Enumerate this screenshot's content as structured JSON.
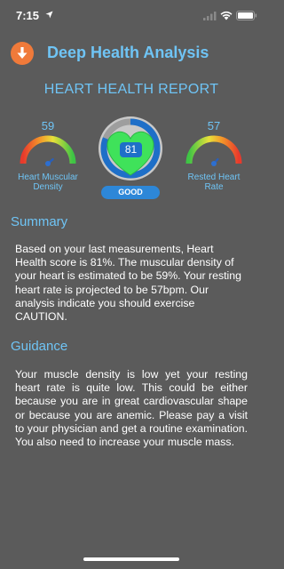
{
  "status_bar": {
    "time": "7:15"
  },
  "header": {
    "title": "Deep Health Analysis",
    "download_icon": "download-arrow-icon"
  },
  "report": {
    "title": "HEART HEALTH REPORT",
    "left_gauge": {
      "value": "59",
      "label": "Heart Muscular Density",
      "level": 0.59
    },
    "center_gauge": {
      "score": "81",
      "status": "GOOD",
      "progress": 0.81
    },
    "right_gauge": {
      "value": "57",
      "label": "Rested Heart Rate",
      "level": 0.57
    }
  },
  "summary": {
    "heading": "Summary",
    "text": "Based on your last measurements, Heart Health score is 81%. The muscular density of your heart is estimated to be 59%. Your resting heart rate is projected to be 57bpm. Our analysis indicate you should exercise CAUTION."
  },
  "guidance": {
    "heading": "Guidance",
    "text": "Your muscle density is low yet your resting heart rate is quite low. This could be either because you are in great cardiovascular shape or because you are anemic. Please pay a visit to your physician and get a routine examination. You also need to increase your muscle mass."
  },
  "colors": {
    "background": "#5b5b5b",
    "accent": "#6fc4f5",
    "download": "#f07a3a",
    "ring": "#1e6fc8",
    "heart": "#3fe25a"
  }
}
